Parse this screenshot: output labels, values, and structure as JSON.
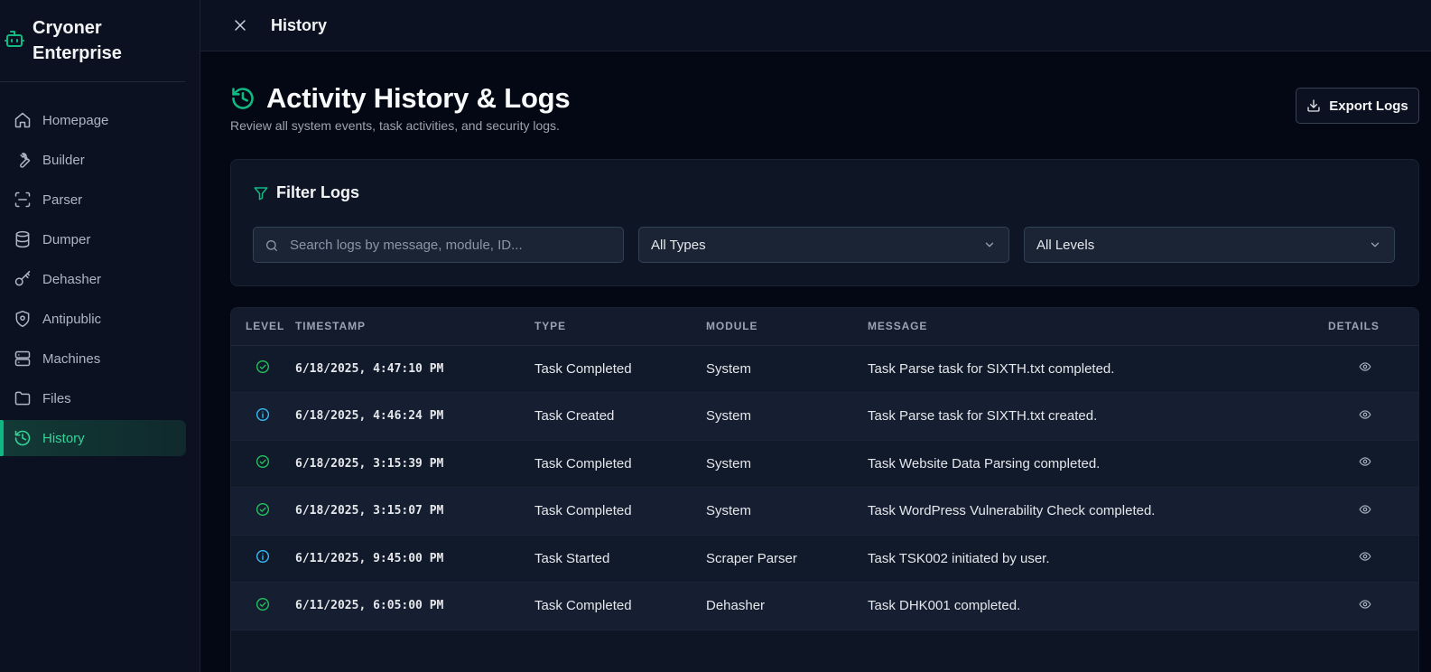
{
  "brand": {
    "name": "Cryoner Enterprise",
    "icon": "bot-icon"
  },
  "sidebar": {
    "items": [
      {
        "label": "Homepage",
        "icon": "home-icon",
        "active": false
      },
      {
        "label": "Builder",
        "icon": "wrench-icon",
        "active": false
      },
      {
        "label": "Parser",
        "icon": "scan-icon",
        "active": false
      },
      {
        "label": "Dumper",
        "icon": "database-icon",
        "active": false
      },
      {
        "label": "Dehasher",
        "icon": "key-icon",
        "active": false
      },
      {
        "label": "Antipublic",
        "icon": "shield-icon",
        "active": false
      },
      {
        "label": "Machines",
        "icon": "server-icon",
        "active": false
      },
      {
        "label": "Files",
        "icon": "folder-icon",
        "active": false
      },
      {
        "label": "History",
        "icon": "history-icon",
        "active": true
      }
    ]
  },
  "topbar": {
    "title": "History"
  },
  "page": {
    "title": "Activity History & Logs",
    "subtitle": "Review all system events, task activities, and security logs.",
    "export_label": "Export Logs"
  },
  "filters": {
    "title": "Filter Logs",
    "search_placeholder": "Search logs by message, module, ID...",
    "type_value": "All Types",
    "level_value": "All Levels"
  },
  "table": {
    "headers": {
      "level": "LEVEL",
      "timestamp": "TIMESTAMP",
      "type": "TYPE",
      "module": "MODULE",
      "message": "MESSAGE",
      "details": "DETAILS"
    },
    "rows": [
      {
        "level": "success",
        "timestamp": "6/18/2025, 4:47:10 PM",
        "type": "Task Completed",
        "module": "System",
        "message": "Task Parse task for SIXTH.txt completed."
      },
      {
        "level": "info",
        "timestamp": "6/18/2025, 4:46:24 PM",
        "type": "Task Created",
        "module": "System",
        "message": "Task Parse task for SIXTH.txt created."
      },
      {
        "level": "success",
        "timestamp": "6/18/2025, 3:15:39 PM",
        "type": "Task Completed",
        "module": "System",
        "message": "Task Website Data Parsing completed."
      },
      {
        "level": "success",
        "timestamp": "6/18/2025, 3:15:07 PM",
        "type": "Task Completed",
        "module": "System",
        "message": "Task WordPress Vulnerability Check completed."
      },
      {
        "level": "info",
        "timestamp": "6/11/2025, 9:45:00 PM",
        "type": "Task Started",
        "module": "Scraper Parser",
        "message": "Task TSK002 initiated by user."
      },
      {
        "level": "success",
        "timestamp": "6/11/2025, 6:05:00 PM",
        "type": "Task Completed",
        "module": "Dehasher",
        "message": "Task DHK001 completed."
      }
    ]
  },
  "colors": {
    "accent": "#10b981",
    "success": "#22c55e",
    "info": "#38bdf8",
    "background": "#040814"
  }
}
